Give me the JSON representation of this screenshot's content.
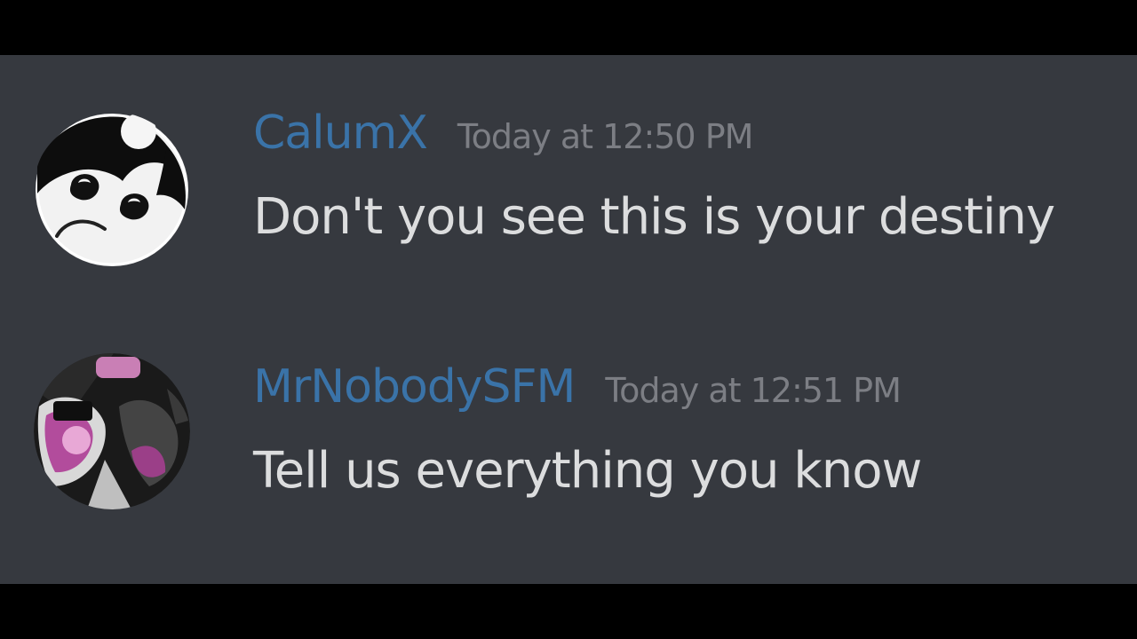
{
  "messages": [
    {
      "username": "CalumX",
      "timestamp": "Today at 12:50 PM",
      "text": "Don't you see this is your destiny",
      "username_color": "#3a73a8",
      "avatar_icon": "cartoon-demon-face-icon"
    },
    {
      "username": "MrNobodySFM",
      "timestamp": "Today at 12:51 PM",
      "text": "Tell us everything you know",
      "username_color": "#3a73a8",
      "avatar_icon": "animatronic-character-icon"
    }
  ],
  "colors": {
    "background": "#36393f",
    "letterbox": "#000000",
    "message_text": "#dcddde",
    "timestamp": "#7c7e84"
  }
}
